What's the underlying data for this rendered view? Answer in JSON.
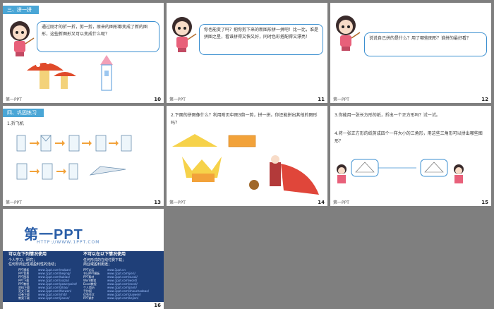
{
  "slides": [
    {
      "num": "10",
      "header": "三、拼一拼",
      "bubble": "通过刚才的折一折，剪一剪，原来的图形都变成了新的图形，这些新图形又可以变成什么呢？"
    },
    {
      "num": "11",
      "bubble": "你也能变了吗？把你剪下来的新图形拼一拼吧！比一比，谁是拼图之星，看谁拼得又快又好，同时色彩搭配得又漂亮！"
    },
    {
      "num": "12",
      "bubble": "说说自己拼的是什么？用了哪些图形？谁拼的最好看？"
    },
    {
      "num": "13",
      "header": "四、巩固练习",
      "item": "1.折飞机"
    },
    {
      "num": "14",
      "text": "2.下面的拼图像什么？利用附页中图3剪一剪，拼一拼。你还能拼出其他的图形吗？"
    },
    {
      "num": "15",
      "text1": "3.你能用一张长方形的纸，折出一个正方形吗？试一试。",
      "text2": "4.将一张正方形的纸剪成四个一样大小的三角形，用这些三角形可以拼出哪些图形？"
    },
    {
      "num": "16",
      "logo": "第一PPT",
      "url": "HTTP://WWW.1PPT.COM",
      "can_title": "可以在下列情况使用",
      "cannot_title": "不可以在以下情况使用",
      "can_lines": [
        "个人学习、研究；",
        "任何非商业性或盈利性的活动；"
      ],
      "cannot_lines": [
        "任何形式的在线付费下载；",
        "商业或盈利用途；"
      ],
      "left_names": [
        "PPT模板",
        "PPT背景",
        "PPT图表",
        "PPT下载",
        "PPT教程",
        "资料下载",
        "范文下载",
        "试卷下载",
        "教案下载"
      ],
      "left_links": [
        "www.1ppt.com/moban/",
        "www.1ppt.com/beijing/",
        "www.1ppt.com/tubiao/",
        "www.1ppt.com/xiazai/",
        "www.1ppt.com/powerpoint/",
        "www.1ppt.com/ziliao/",
        "www.1ppt.com/fanwen/",
        "www.1ppt.com/shiti/",
        "www.1ppt.com/jiaoan/"
      ],
      "right_names": [
        "PPT论坛",
        "节日PPT模板",
        "PPT素材",
        "Word教程",
        "Excel教程",
        "个人简历",
        "手抄报",
        "优秀作文",
        "PPT课件"
      ],
      "right_links": [
        "www.1ppt.cn",
        "www.1ppt.com/jieri/",
        "www.1ppt.com/sucai/",
        "www.1ppt.com/word/",
        "www.1ppt.com/excel/",
        "www.1ppt.com/jianli/",
        "www.1ppt.com/shouchaobao/",
        "www.1ppt.com/zuowen/",
        "www.1ppt.com/kejian/"
      ]
    }
  ],
  "footer_logo": "第一PPT"
}
